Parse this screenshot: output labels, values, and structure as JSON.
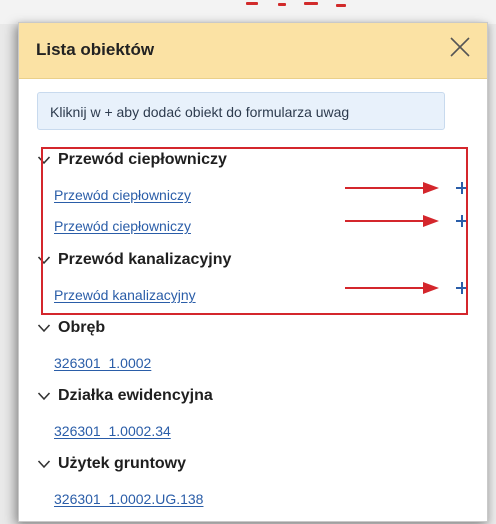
{
  "colors": {
    "header_background": "#fbe2a4",
    "link": "#2a5da8",
    "annotation_red": "#d4262c",
    "info_background": "#e8f1fb"
  },
  "panel": {
    "title": "Lista obiektów",
    "close_icon": "close-icon"
  },
  "info": {
    "text": "Kliknij w + aby dodać obiekt do formularza uwag"
  },
  "groups": [
    {
      "label": "Przewód ciepłowniczy",
      "items": [
        "Przewód ciepłowniczy",
        "Przewód ciepłowniczy"
      ]
    },
    {
      "label": "Przewód kanalizacyjny",
      "items": [
        "Przewód kanalizacyjny"
      ]
    },
    {
      "label": "Obręb",
      "items": [
        "326301_1.0002"
      ]
    },
    {
      "label": "Działka ewidencyjna",
      "items": [
        "326301_1.0002.34"
      ]
    },
    {
      "label": "Użytek gruntowy",
      "items": [
        "326301_1.0002.UG.138"
      ]
    }
  ]
}
